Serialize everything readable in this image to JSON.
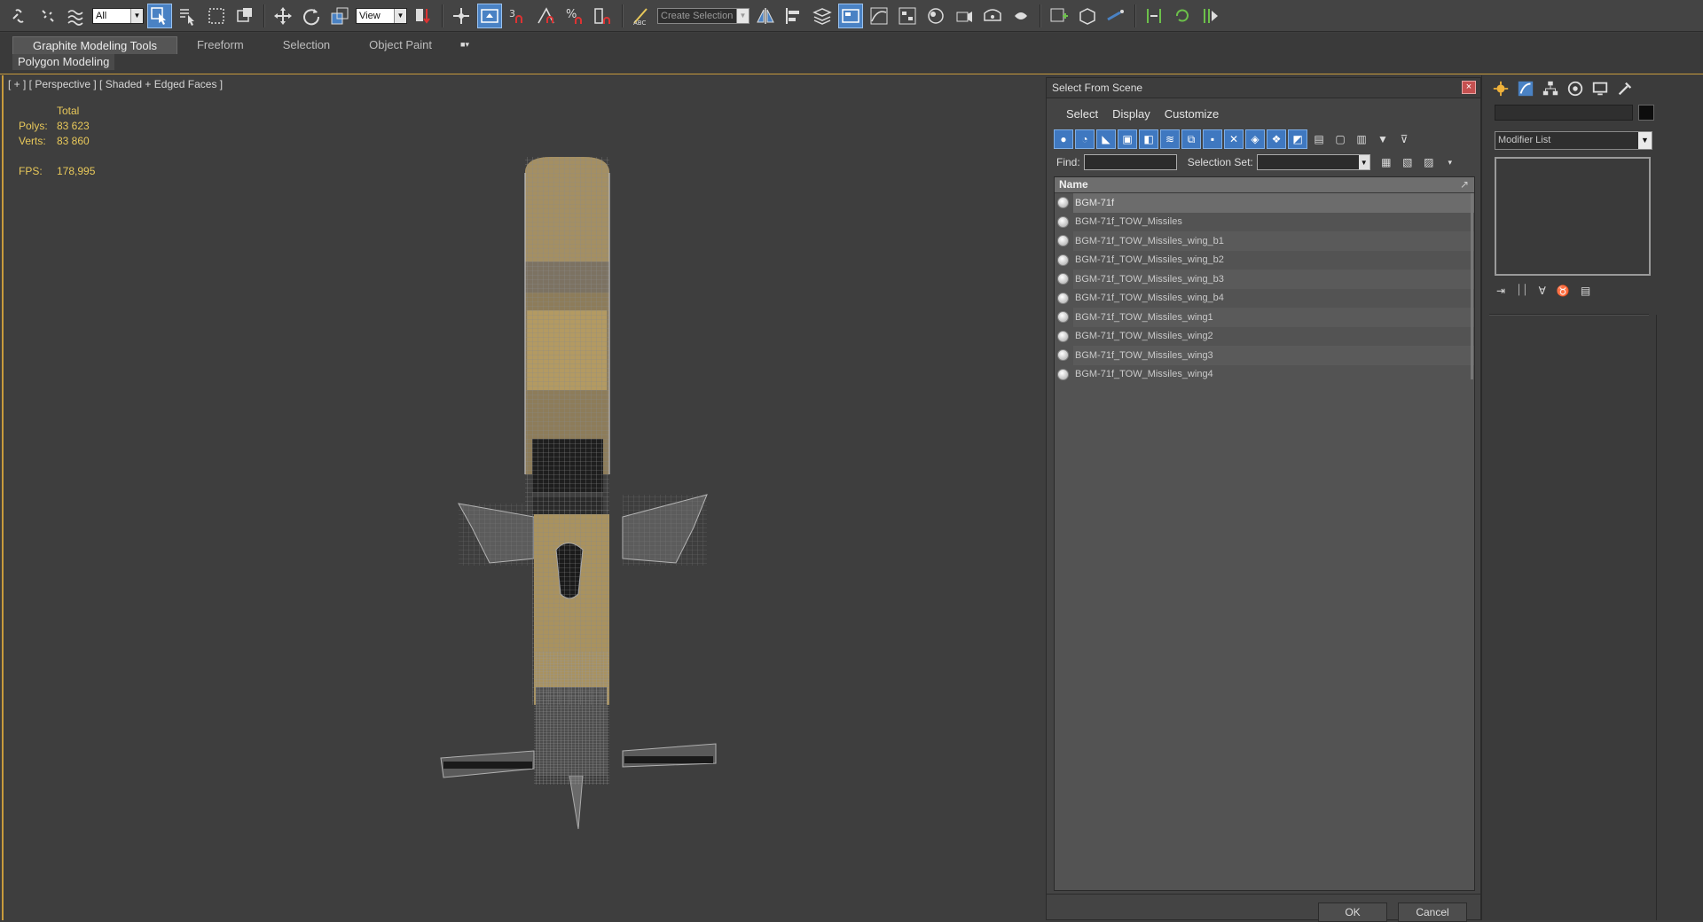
{
  "toolbar": {
    "selection_filter": "All",
    "reference_coord": "View",
    "named_selection": "Create Selection Se"
  },
  "ribbon": {
    "tabs": [
      "Graphite Modeling Tools",
      "Freeform",
      "Selection",
      "Object Paint"
    ],
    "active_tab": "Graphite Modeling Tools",
    "panel_label": "Polygon Modeling"
  },
  "viewport": {
    "label": "[ + ] [ Perspective ] [ Shaded + Edged Faces ]",
    "stats": {
      "header": "Total",
      "polys_label": "Polys:",
      "polys_value": "83 623",
      "verts_label": "Verts:",
      "verts_value": "83 860",
      "fps_label": "FPS:",
      "fps_value": "178,995"
    }
  },
  "dialog": {
    "title": "Select From Scene",
    "close_glyph": "×",
    "menu": [
      "Select",
      "Display",
      "Customize"
    ],
    "find_label": "Find:",
    "selection_set_label": "Selection Set:",
    "column_header": "Name",
    "objects": [
      "BGM-71f",
      "BGM-71f_TOW_Missiles",
      "BGM-71f_TOW_Missiles_wing_b1",
      "BGM-71f_TOW_Missiles_wing_b2",
      "BGM-71f_TOW_Missiles_wing_b3",
      "BGM-71f_TOW_Missiles_wing_b4",
      "BGM-71f_TOW_Missiles_wing1",
      "BGM-71f_TOW_Missiles_wing2",
      "BGM-71f_TOW_Missiles_wing3",
      "BGM-71f_TOW_Missiles_wing4"
    ],
    "selected_index": 0,
    "ok_label": "OK",
    "cancel_label": "Cancel"
  },
  "command_panel": {
    "modifier_list": "Modifier List"
  },
  "colors": {
    "accent_blue": "#3f78c0",
    "viewport_border": "#c89b3c",
    "stats_text": "#e8c85a"
  }
}
